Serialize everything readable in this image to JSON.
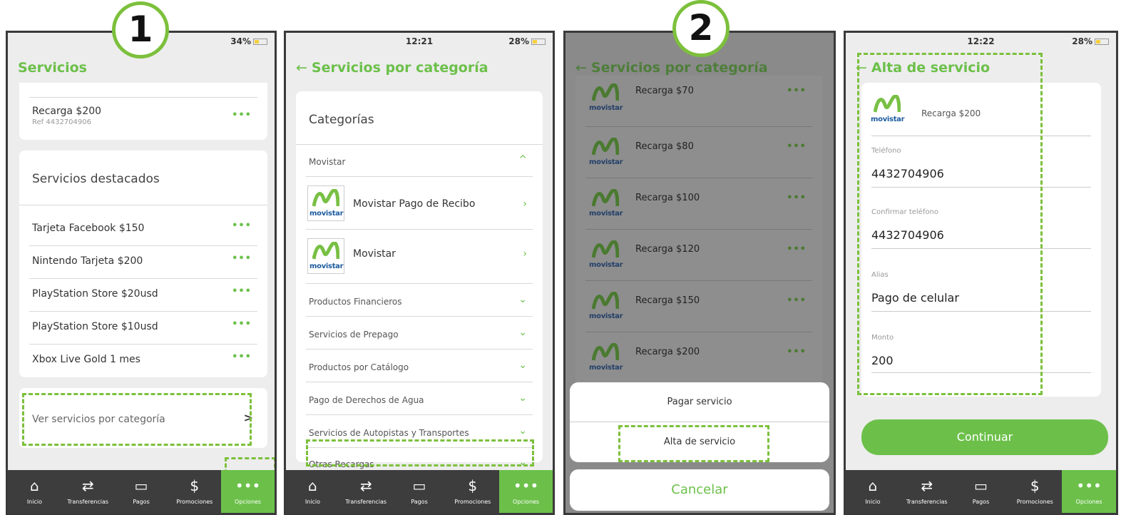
{
  "badges": {
    "one": "1",
    "two": "2"
  },
  "screen1": {
    "title": "Servicios",
    "battery": "34%",
    "saved": {
      "name": "Recarga $200",
      "ref": "Ref 4432704906"
    },
    "featured_title": "Servicios destacados",
    "featured": [
      {
        "label": "Tarjeta Facebook $150"
      },
      {
        "label": "Nintendo Tarjeta $200"
      },
      {
        "label": "PlayStation Store $20usd"
      },
      {
        "label": "PlayStation Store $10usd"
      },
      {
        "label": "Xbox Live Gold 1 mes"
      }
    ],
    "dots": "•••",
    "category_link": "Ver servicios por categoría",
    "category_chevron": ">"
  },
  "screen2": {
    "title": "Servicios por categoría",
    "time": "12:21",
    "battery": "28%",
    "section": "Categorías",
    "expanded": "Movistar",
    "items": [
      {
        "label": "Movistar Pago de Recibo"
      },
      {
        "label": "Movistar"
      }
    ],
    "categories": [
      {
        "label": "Productos Financieros"
      },
      {
        "label": "Servicios de Prepago"
      },
      {
        "label": "Productos por Catálogo"
      },
      {
        "label": "Pago de Derechos de Agua"
      },
      {
        "label": "Servicios de Autopistas y Transportes"
      },
      {
        "label": "Otras Recargas"
      }
    ]
  },
  "screen3": {
    "title": "Servicios por categoría",
    "recargas": [
      {
        "label": "Recarga $70"
      },
      {
        "label": "Recarga $80"
      },
      {
        "label": "Recarga $100"
      },
      {
        "label": "Recarga $120"
      },
      {
        "label": "Recarga $150"
      },
      {
        "label": "Recarga $200"
      }
    ],
    "sheet": {
      "pay": "Pagar servicio",
      "add": "Alta de servicio",
      "cancel": "Cancelar"
    }
  },
  "screen4": {
    "title": "Alta de servicio",
    "time": "12:22",
    "battery": "28%",
    "service": "Recarga $200",
    "fields": [
      {
        "label": "Teléfono",
        "value": "4432704906"
      },
      {
        "label": "Confirmar teléfono",
        "value": "4432704906"
      },
      {
        "label": "Alias",
        "value": "Pago de celular"
      },
      {
        "label": "Monto",
        "value": "200"
      }
    ],
    "continue": "Continuar"
  },
  "movistar_text": "movistar",
  "tabs": [
    {
      "label": "Inicio",
      "icon": "home-icon"
    },
    {
      "label": "Transferencias",
      "icon": "transfer-icon"
    },
    {
      "label": "Pagos",
      "icon": "payments-icon"
    },
    {
      "label": "Promociones",
      "icon": "promotions-icon"
    },
    {
      "label": "Opciones",
      "icon": "more-icon"
    }
  ],
  "tab_glyphs": {
    "home": "⌂",
    "transfer": "⇄",
    "payments": "▭",
    "promo": "$",
    "more": "•••"
  },
  "colors": {
    "accent": "#6cc04a",
    "tabbar": "#3d3d3d",
    "movistar_blue": "#1c5b9f"
  }
}
